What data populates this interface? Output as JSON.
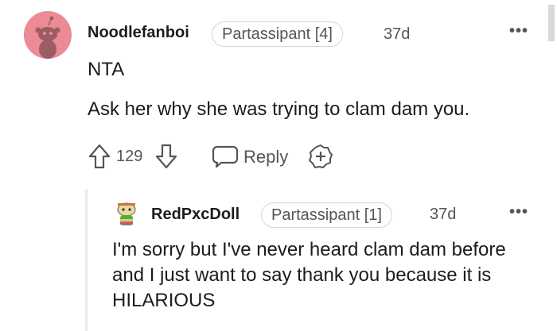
{
  "comment": {
    "author": "Noodlefanboi",
    "flair": "Partassipant [4]",
    "age": "37d",
    "more": "•••",
    "body_lines": [
      "NTA",
      "Ask her why she was trying to clam dam you."
    ],
    "votes": "129",
    "reply_label": "Reply"
  },
  "reply": {
    "author": "RedPxcDoll",
    "flair": "Partassipant [1]",
    "age": "37d",
    "more": "•••",
    "body": "I'm sorry but I've never heard clam dam before and I just want to say thank you because it is HILARIOUS"
  },
  "icons": {
    "avatar": "reddit-snoo-avatar",
    "avatar2": "custom-snoo-avatar",
    "upvote": "upvote-arrow-icon",
    "downvote": "downvote-arrow-icon",
    "reply": "chat-bubble-icon",
    "award": "award-plus-icon",
    "more": "more-dots-icon"
  },
  "colors": {
    "avatar_bg": "#ec8b95",
    "muted_text": "#555555",
    "text": "#1c1c1c"
  }
}
